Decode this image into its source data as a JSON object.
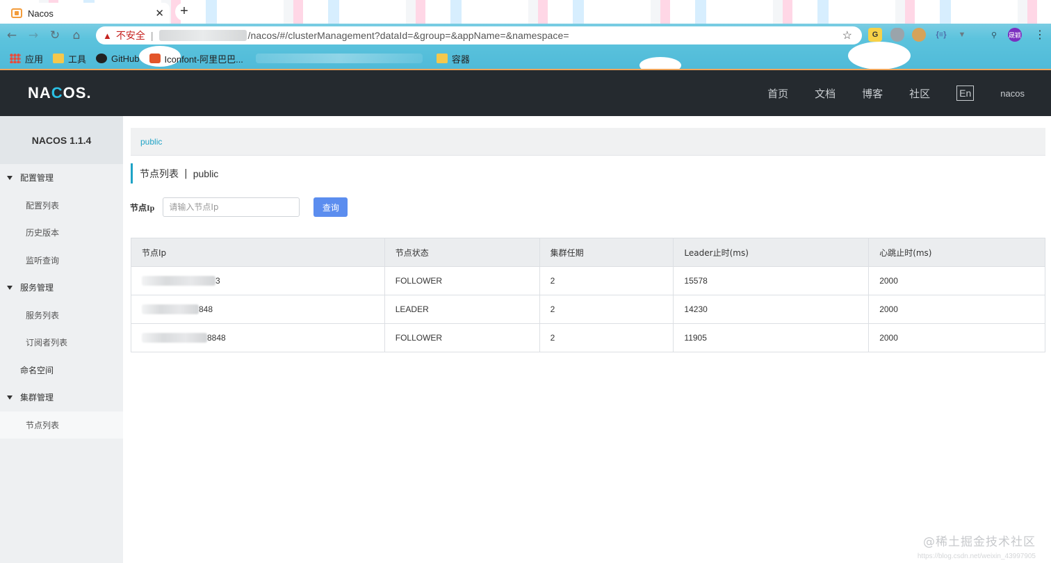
{
  "browser": {
    "tab_title": "Nacos",
    "tab_close": "✕",
    "new_tab": "+",
    "security_label": "不安全",
    "separator": "|",
    "url_path": "/nacos/#/clusterManagement?dataId=&group=&appName=&namespace=",
    "bookmarks": [
      "应用",
      "工具",
      "GitHub",
      "Iconfont-阿里巴巴...",
      "容器"
    ],
    "profile_label": "晟颖",
    "extension_g": "G"
  },
  "header": {
    "logo_pre": "NA",
    "logo_o": "C",
    "logo_post": "OS.",
    "nav": [
      "首页",
      "文档",
      "博客",
      "社区"
    ],
    "lang": "En",
    "user": "nacos"
  },
  "sidebar": {
    "title": "NACOS 1.1.4",
    "groups": [
      {
        "label": "配置管理",
        "items": [
          "配置列表",
          "历史版本",
          "监听查询"
        ]
      },
      {
        "label": "服务管理",
        "items": [
          "服务列表",
          "订阅者列表"
        ]
      }
    ],
    "namespace": "命名空间",
    "cluster_group": "集群管理",
    "cluster_items": [
      "节点列表"
    ]
  },
  "main": {
    "breadcrumb": "public",
    "title": "节点列表",
    "title_sep": "|",
    "namespace": "public",
    "search_label": "节点Ip",
    "search_placeholder": "请输入节点Ip",
    "search_button": "查询",
    "table": {
      "headers": [
        "节点Ip",
        "节点状态",
        "集群任期",
        "Leader止时(ms)",
        "心跳止时(ms)"
      ],
      "rows": [
        {
          "ip_suffix": "3",
          "status": "FOLLOWER",
          "term": "2",
          "leader_due": "15578",
          "heartbeat_due": "2000"
        },
        {
          "ip_suffix": "848",
          "status": "LEADER",
          "term": "2",
          "leader_due": "14230",
          "heartbeat_due": "2000"
        },
        {
          "ip_suffix": "8848",
          "status": "FOLLOWER",
          "term": "2",
          "leader_due": "11905",
          "heartbeat_due": "2000"
        }
      ]
    }
  },
  "watermark": "@稀土掘金技术社区",
  "watermark_sub": "https://blog.csdn.net/weixin_43997905",
  "colors": {
    "header_bg": "#252a2f",
    "accent": "#1fa3c6",
    "button": "#5b8def"
  }
}
